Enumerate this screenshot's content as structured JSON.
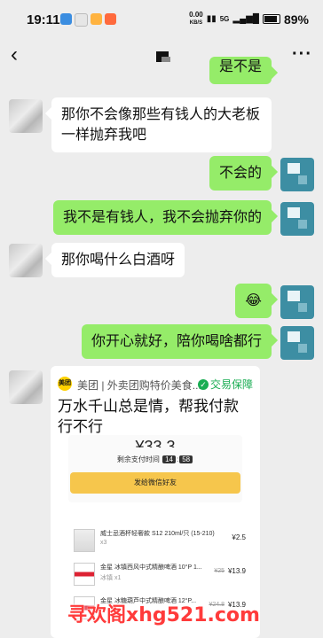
{
  "status_bar": {
    "time": "19:11",
    "net_speed_value": "0.00",
    "net_speed_unit": "KB/S",
    "network": "5G",
    "battery": "89%"
  },
  "nav": {
    "back_icon": "chevron-left-icon",
    "more_icon": "ellipsis-icon"
  },
  "messages": [
    {
      "side": "right",
      "text": "是不是"
    },
    {
      "side": "left",
      "text": "那你不会像那些有钱人的大老板一样抛弃我吧"
    },
    {
      "side": "right",
      "text": "不会的"
    },
    {
      "side": "right",
      "text": "我不是有钱人，我不会抛弃你的"
    },
    {
      "side": "left",
      "text": "那你喝什么白酒呀"
    },
    {
      "side": "right",
      "text": "😂"
    },
    {
      "side": "right",
      "text": "你开心就好，陪你喝啥都行"
    }
  ],
  "share_card": {
    "logo_text": "美团",
    "source": "美团 | 外卖团购特价美食...",
    "guarantee": "交易保障",
    "title": "万水千山总是情，帮我付款行不行",
    "price": "¥33.3",
    "countdown_label": "剩余支付时间",
    "countdown_min": "14",
    "countdown_sec": "58",
    "pay_button": "发给微信好友",
    "items": [
      {
        "name": "威士忌酒杯轻奢款 S12 210ml/只 (15-210)",
        "sub": "x3",
        "orig": "",
        "amount": "¥2.5"
      },
      {
        "name": "金星 冰镇西风中式精酿啤酒 10°P 1...",
        "sub": "冰镇 x1",
        "orig": "¥25",
        "amount": "¥13.9"
      },
      {
        "name": "金星 冰糖葫芦中式精酿啤酒 12°P...",
        "sub": "",
        "orig": "¥24.8",
        "amount": "¥13.9"
      }
    ]
  },
  "watermark": "寻欢阁xhg521.com"
}
